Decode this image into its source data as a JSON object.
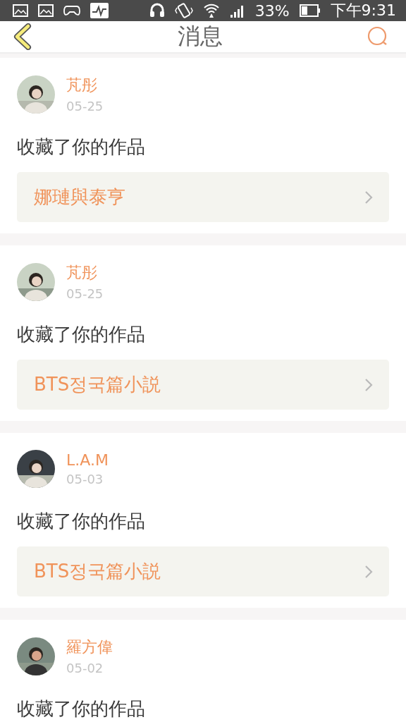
{
  "status_bar": {
    "battery": "33%",
    "time": "下午9:31"
  },
  "header": {
    "title": "消息"
  },
  "messages": [
    {
      "user": "芃彤",
      "date": "05-25",
      "action": "收藏了你的作品",
      "work": "娜璉與泰亨"
    },
    {
      "user": "芃彤",
      "date": "05-25",
      "action": "收藏了你的作品",
      "work": "BTS정국篇小説"
    },
    {
      "user": "L.A.M",
      "date": "05-03",
      "action": "收藏了你的作品",
      "work": "BTS정국篇小説"
    },
    {
      "user": "羅方偉",
      "date": "05-02",
      "action": "收藏了你的作品"
    }
  ]
}
